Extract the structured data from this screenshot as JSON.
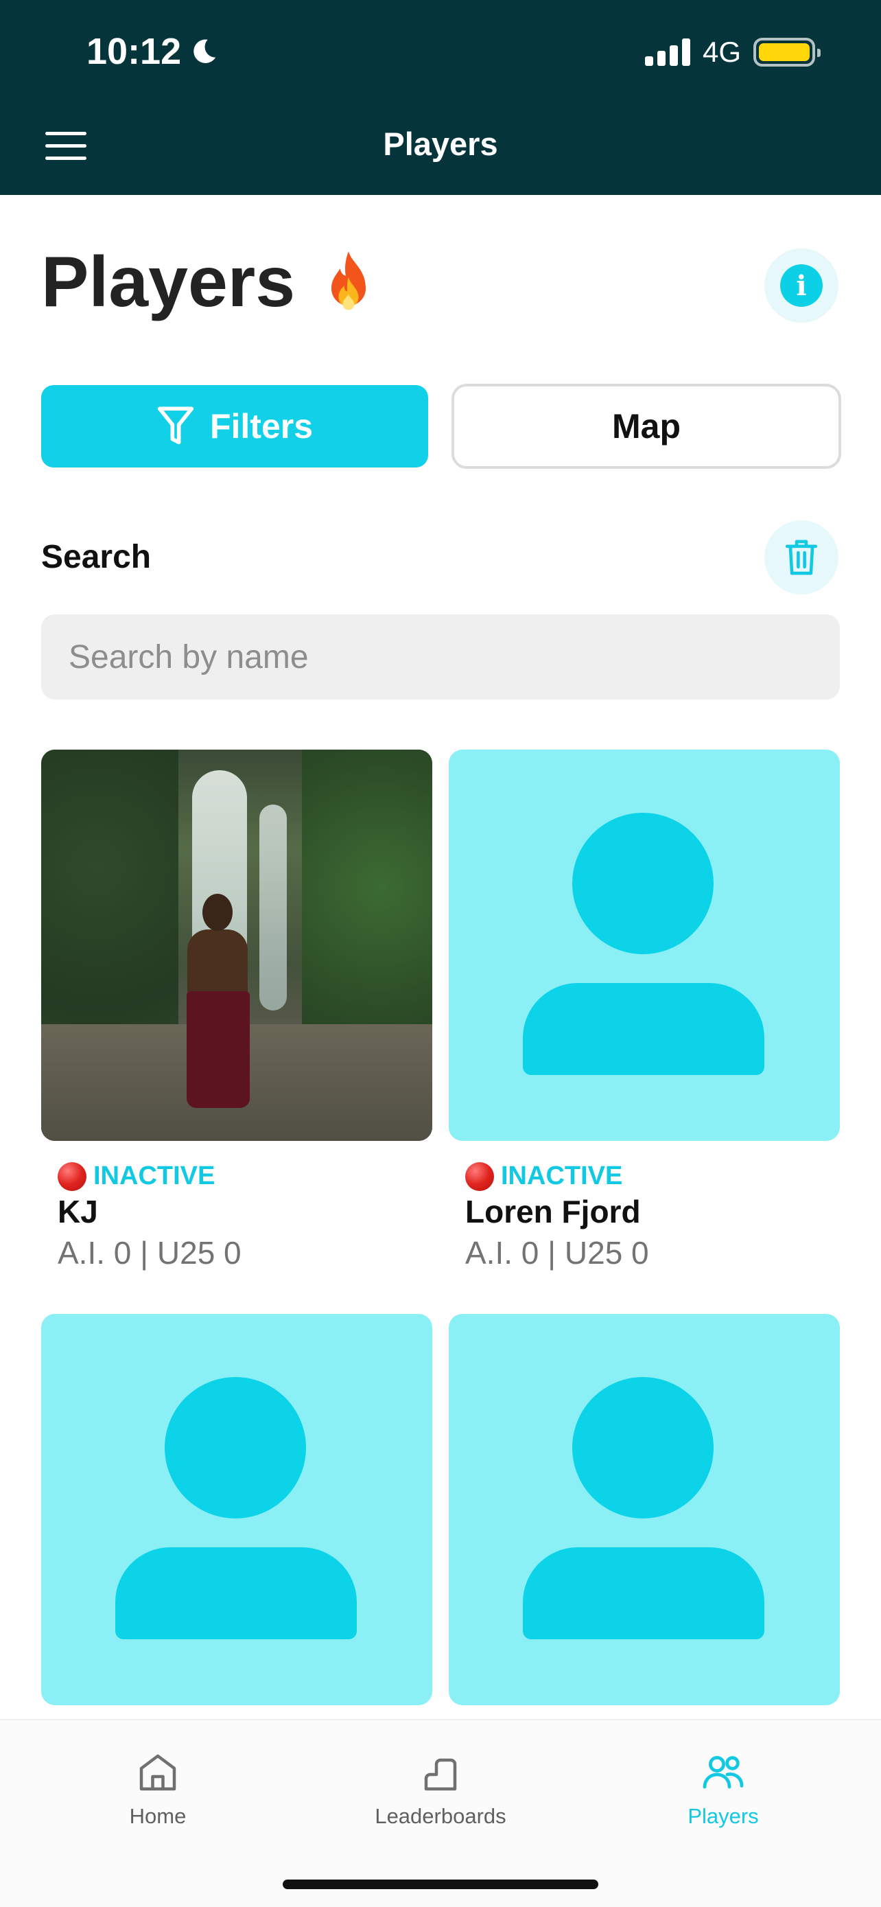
{
  "status_bar": {
    "time": "10:12",
    "network": "4G",
    "icons": [
      "moon-icon",
      "signal-icon",
      "battery-icon"
    ]
  },
  "header": {
    "title": "Players",
    "menu_icon": "menu-icon"
  },
  "page": {
    "title": "Players",
    "title_emoji_icon": "fire-icon",
    "info_icon": "info-icon"
  },
  "actions": {
    "filters_label": "Filters",
    "map_label": "Map"
  },
  "search": {
    "label": "Search",
    "placeholder": "Search by name",
    "value": "",
    "clear_icon": "trash-icon"
  },
  "players": [
    {
      "status": "INACTIVE",
      "name": "KJ",
      "stats": "A.I. 0 | U25 0",
      "photo": "photo"
    },
    {
      "status": "INACTIVE",
      "name": "Loren Fjord",
      "stats": "A.I. 0 | U25 0",
      "photo": "placeholder"
    },
    {
      "status": "",
      "name": "",
      "stats": "",
      "photo": "placeholder"
    },
    {
      "status": "",
      "name": "",
      "stats": "",
      "photo": "placeholder"
    }
  ],
  "bottom_nav": {
    "items": [
      {
        "label": "Home",
        "icon": "home-icon",
        "active": false
      },
      {
        "label": "Leaderboards",
        "icon": "stairs-icon",
        "active": false
      },
      {
        "label": "Players",
        "icon": "users-icon",
        "active": true
      }
    ]
  },
  "colors": {
    "header_bg": "#05353b",
    "accent": "#11d0e8",
    "placeholder_bg": "#8af0f6",
    "status_inactive": "#e0241f"
  }
}
